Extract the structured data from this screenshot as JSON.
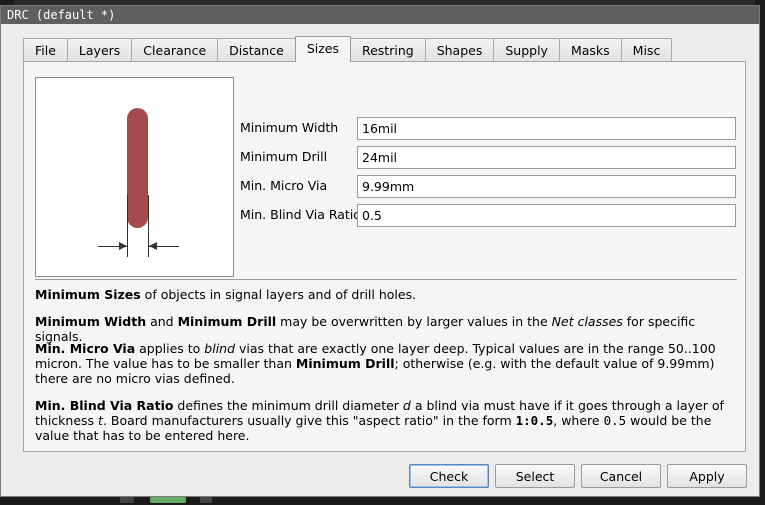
{
  "window": {
    "title": "DRC (default *)"
  },
  "tabs": [
    {
      "label": "File"
    },
    {
      "label": "Layers"
    },
    {
      "label": "Clearance"
    },
    {
      "label": "Distance"
    },
    {
      "label": "Sizes",
      "active": true
    },
    {
      "label": "Restring"
    },
    {
      "label": "Shapes"
    },
    {
      "label": "Supply"
    },
    {
      "label": "Masks"
    },
    {
      "label": "Misc"
    }
  ],
  "fields": {
    "min_width": {
      "label": "Minimum Width",
      "value": "16mil"
    },
    "min_drill": {
      "label": "Minimum Drill",
      "value": "24mil"
    },
    "min_micro_via": {
      "label": "Min. Micro Via",
      "value": "9.99mm"
    },
    "min_blind_ratio": {
      "label": "Min. Blind Via Ratio",
      "value": "0.5"
    }
  },
  "description": {
    "p1": {
      "b1": "Minimum Sizes",
      "t1": " of objects in signal layers and of drill holes."
    },
    "p2": {
      "b1": "Minimum Width",
      "t1": " and ",
      "b2": "Minimum Drill",
      "t2": " may be overwritten by larger values in the ",
      "i1": "Net classes",
      "t3": " for specific signals."
    },
    "p3": {
      "b1": "Min. Micro Via",
      "t1": " applies to ",
      "i1": "blind",
      "t2": " vias that are exactly one layer deep. Typical values are in the range 50..100 micron. The value has to be smaller than ",
      "b2": "Minimum Drill",
      "t3": "; otherwise (e.g. with the default value of 9.99mm) there are no micro vias defined."
    },
    "p4": {
      "b1": "Min. Blind Via Ratio",
      "t1": " defines the minimum drill diameter ",
      "i1": "d",
      "t2": " a blind via must have if it goes through a layer of thickness ",
      "i2": "t",
      "t3": ". Board manufacturers usually give this \"aspect ratio\" in the form ",
      "m1": "1:0.5",
      "t4": ", where ",
      "m2": "0.5",
      "t5": " would be the value that has to be entered here."
    }
  },
  "buttons": {
    "check": "Check",
    "select": "Select",
    "cancel": "Cancel",
    "apply": "Apply"
  },
  "colors": {
    "trace": "#a54b4b",
    "default_button_border": "#5a86b8"
  }
}
